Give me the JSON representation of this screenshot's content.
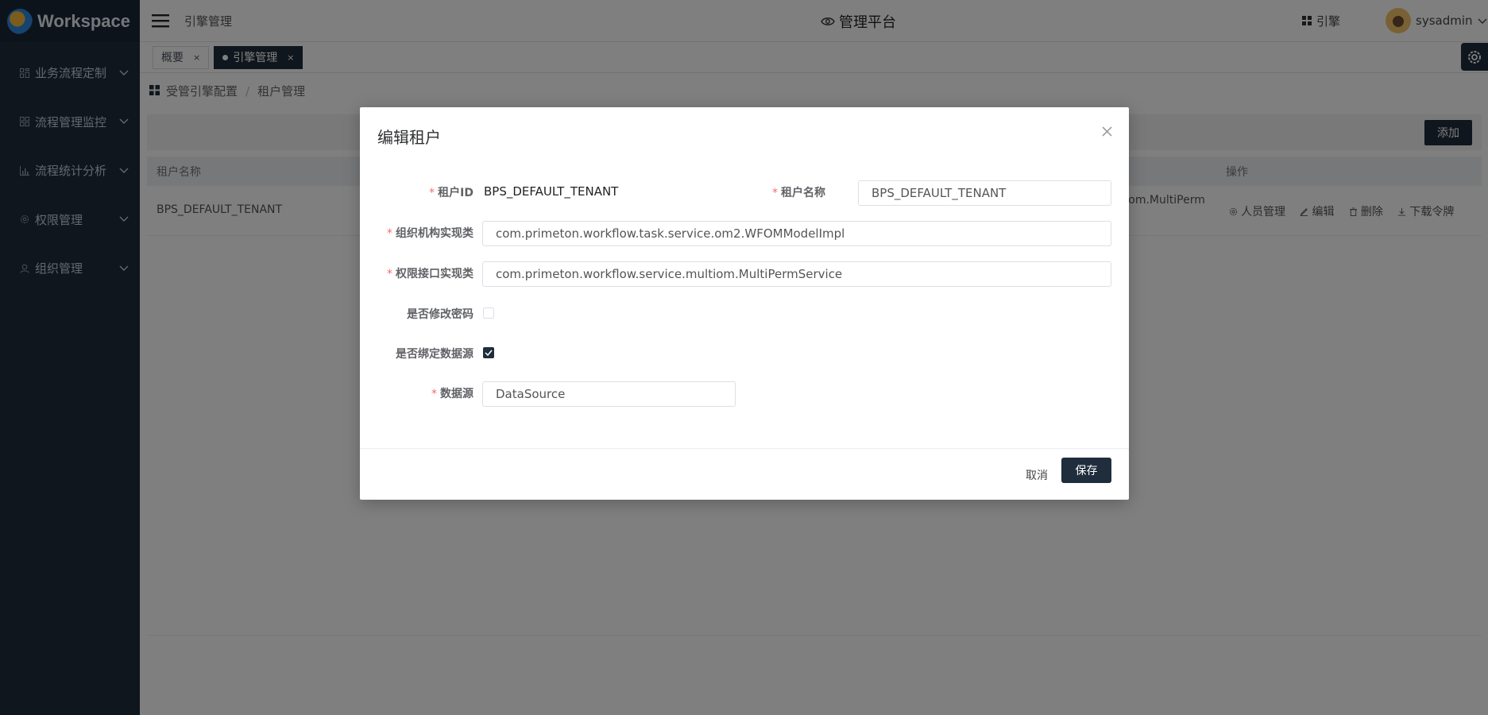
{
  "app": {
    "logo_text": "Workspace"
  },
  "sidebar": {
    "items": [
      {
        "label": "业务流程定制",
        "icon": "flow-design-icon"
      },
      {
        "label": "流程管理监控",
        "icon": "monitor-icon"
      },
      {
        "label": "流程统计分析",
        "icon": "chart-icon"
      },
      {
        "label": "权限管理",
        "icon": "gear-icon"
      },
      {
        "label": "组织管理",
        "icon": "user-icon"
      }
    ]
  },
  "header": {
    "page_name": "引擎管理",
    "center_title": "管理平台",
    "engine_label": "引擎",
    "username": "sysadmin"
  },
  "tabs": [
    {
      "label": "概要",
      "active": false
    },
    {
      "label": "引擎管理",
      "active": true
    }
  ],
  "breadcrumb": {
    "parent": "受管引擎配置",
    "current": "租户管理"
  },
  "toolbar": {
    "add_label": "添加"
  },
  "table": {
    "columns": {
      "name": "租户名称",
      "ops": "操作"
    },
    "rows": [
      {
        "name": "BPS_DEFAULT_TENANT",
        "partial_text": "ltiom.MultiPerm",
        "ops": [
          "人员管理",
          "编辑",
          "删除",
          "下载令牌"
        ]
      }
    ]
  },
  "modal": {
    "title": "编辑租户",
    "fields": {
      "tenant_id_label": "租户ID",
      "tenant_id_value": "BPS_DEFAULT_TENANT",
      "tenant_name_label": "租户名称",
      "tenant_name_value": "BPS_DEFAULT_TENANT",
      "org_impl_label": "组织机构实现类",
      "org_impl_value": "com.primeton.workflow.task.service.om2.WFOMModelImpl",
      "perm_impl_label": "权限接口实现类",
      "perm_impl_value": "com.primeton.workflow.service.multiom.MultiPermService",
      "change_pwd_label": "是否修改密码",
      "change_pwd_checked": false,
      "bind_ds_label": "是否绑定数据源",
      "bind_ds_checked": true,
      "datasource_label": "数据源",
      "datasource_value": "DataSource"
    },
    "cancel_label": "取消",
    "save_label": "保存"
  },
  "colors": {
    "primary": "#1f2d3d",
    "required": "#f56c6c"
  }
}
